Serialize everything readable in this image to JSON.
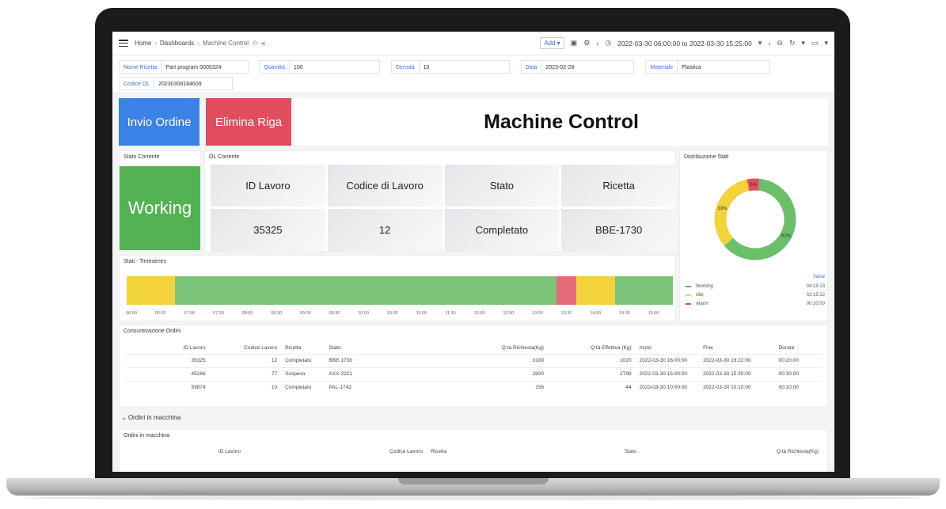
{
  "topbar": {
    "breadcrumb": [
      "Home",
      "Dashboards",
      "Machine Control"
    ],
    "add_label": "Add",
    "time_range": "2022-03-30 06:00:00 to 2022-03-30 15:25:00"
  },
  "variables": [
    {
      "label": "Nome Ricetta",
      "value": "Part program 0005324"
    },
    {
      "label": "Quantità",
      "value": "100"
    },
    {
      "label": "Densità",
      "value": "10"
    },
    {
      "label": "Data",
      "value": "2023-02-28"
    },
    {
      "label": "Materiale",
      "value": "Plastica"
    },
    {
      "label": "Codice OL",
      "value": "20230308184609"
    }
  ],
  "buttons": {
    "invio": "Invio Ordine",
    "elimina": "Elimina Riga"
  },
  "title": "Machine Control",
  "stato_corrente": {
    "title": "Stato Corrente",
    "value": "Working"
  },
  "ol_corrente": {
    "title": "OL Corrente",
    "headers": [
      "ID Lavoro",
      "Codice di Lavoro",
      "Stato",
      "Ricetta"
    ],
    "values": [
      "35325",
      "12",
      "Completato",
      "BBE-1730"
    ]
  },
  "distribuzione": {
    "title": "Distribuzione Stati",
    "value_header": "Value",
    "legend": [
      {
        "name": "Working",
        "value": "04:15:13",
        "color": "#5cb85c"
      },
      {
        "name": "Idle",
        "value": "02:15:12",
        "color": "#f2d33b"
      },
      {
        "name": "Alarm",
        "value": "00:20:00",
        "color": "#e24d5d"
      }
    ],
    "slices": [
      {
        "label": "62%",
        "pct": 62,
        "color": "#6cbf6a"
      },
      {
        "label": "33%",
        "pct": 33,
        "color": "#f2d33b"
      },
      {
        "label": "5%",
        "pct": 5,
        "color": "#e24d5d"
      }
    ]
  },
  "timeseries": {
    "title": "Stati - Timeseries",
    "ticks": [
      "06:00",
      "06:30",
      "07:00",
      "07:30",
      "08:00",
      "08:30",
      "09:00",
      "09:30",
      "10:00",
      "10:30",
      "11:00",
      "11:30",
      "12:00",
      "12:30",
      "13:00",
      "13:30",
      "14:00",
      "14:30",
      "15:00"
    ],
    "segments": [
      {
        "state": "Idle",
        "from": "06:00",
        "to": "06:50",
        "color": "#f2d33b"
      },
      {
        "state": "Working",
        "from": "06:50",
        "to": "13:25",
        "color": "#7cc47a"
      },
      {
        "state": "Alarm",
        "from": "13:25",
        "to": "13:45",
        "color": "#e66a78"
      },
      {
        "state": "Idle",
        "from": "13:45",
        "to": "14:25",
        "color": "#f2d33b"
      },
      {
        "state": "Working",
        "from": "14:25",
        "to": "15:25",
        "color": "#7cc47a"
      }
    ]
  },
  "consuntivazione": {
    "title": "Consuntivazione Ordini",
    "columns": [
      "ID Lavoro",
      "Codice Lavoro",
      "Ricetta",
      "Stato",
      "Q.tà Richiesta(Kg)",
      "Q.tà Effettiva (Kg)",
      "Inizio",
      "Fine",
      "Durata"
    ],
    "rows": [
      [
        "35325",
        "12",
        "Completato",
        "BBE-1730",
        "3100",
        "1020",
        "2022-03-30 16:00:00",
        "2022-03-30 16:22:00",
        "00:20:00"
      ],
      [
        "45266",
        "77",
        "Sospeso",
        "AXX-2221",
        "2800",
        "2799",
        "2022-03-30 15:00:00",
        "2022-03-30 15:30:00",
        "00:30:00"
      ],
      [
        "59874",
        "10",
        "Completato",
        "PAL-1742",
        "156",
        "44",
        "2022-03-30 10:00:00",
        "2022-03-30 10:10:00",
        "00:10:00"
      ]
    ]
  },
  "ordini_row": "Ordini in macchina",
  "ordini": {
    "title": "Ordini in macchina",
    "columns": [
      "ID Lavoro",
      "Codice Lavoro",
      "Ricetta",
      "Stato",
      "Q.tà Richiesta(Kg)"
    ]
  }
}
